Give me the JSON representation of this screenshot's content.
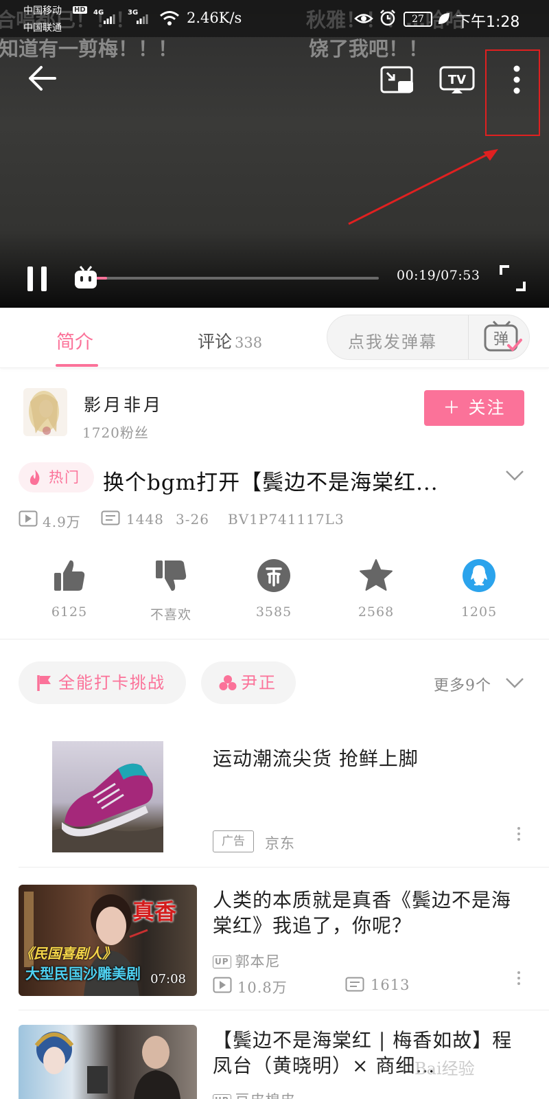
{
  "status_bar": {
    "carrier_1": "中国移动",
    "hd": "HD",
    "net_1": "4G",
    "carrier_2": "中国联通",
    "net_2": "3G",
    "speed": "2.46K/s",
    "battery": "27",
    "time": "下午1:28"
  },
  "danmaku": [
    "合唱都已！！！",
    "秋雅！！！…哈哈",
    "知道有一剪梅！！！",
    "饶了我吧！！"
  ],
  "player": {
    "time_display": "00:19/07:53",
    "progress": 0.04
  },
  "tabs": {
    "intro": "简介",
    "comments": "评论",
    "comments_count": "338",
    "danmaku_placeholder": "点我发弹幕",
    "danmaku_button": "弹"
  },
  "uploader": {
    "name": "影月非月",
    "fans": "1720粉丝",
    "follow": "＋ 关注"
  },
  "video": {
    "hot_badge": "热门",
    "title": "换个bgm打开【鬓边不是海棠红...",
    "views": "4.9万",
    "danmaku_count": "1448",
    "date": "3-26",
    "bvid": "BV1P741117L3"
  },
  "actions": {
    "like": "6125",
    "dislike": "不喜欢",
    "coin": "3585",
    "favorite": "2568",
    "share": "1205"
  },
  "tags": {
    "items": [
      "全能打卡挑战",
      "尹正"
    ],
    "more": "更多9个"
  },
  "recommendations": [
    {
      "title": "运动潮流尖货 抢鲜上脚",
      "ad_label": "广告",
      "source": "京东"
    },
    {
      "title": "人类的本质就是真香《鬓边不是海棠红》我追了，你呢？",
      "up_badge": "UP",
      "author": "郭本尼",
      "views": "10.8万",
      "danmaku": "1613",
      "duration": "07:08",
      "thumb_text_1": "真香",
      "thumb_text_2": "《民国喜剧人》",
      "thumb_text_3": "大型民国沙雕美剧"
    },
    {
      "title": "【鬓边不是海棠红 | 梅香如故】程凤台（黄晓明）× 商细…",
      "up_badge": "UP",
      "author": "豆皮棉皮"
    }
  ],
  "watermark": "Bai经验"
}
